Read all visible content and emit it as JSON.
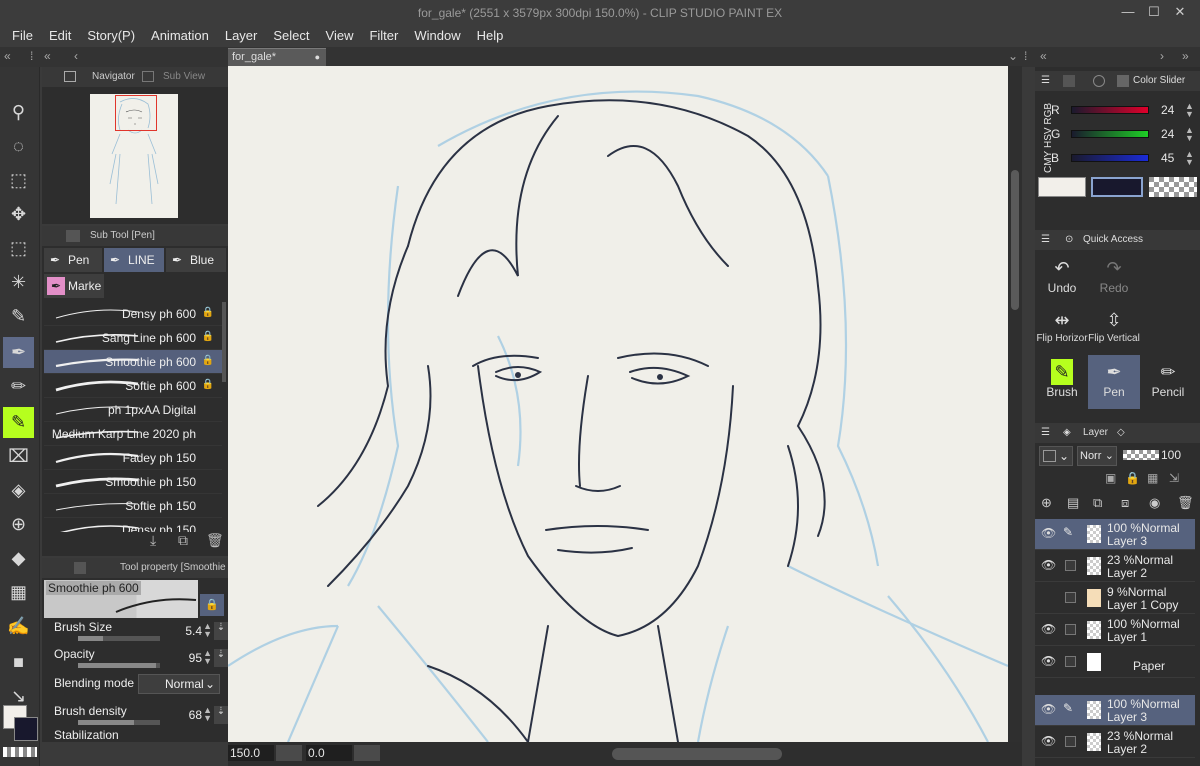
{
  "window": {
    "title": "for_gale* (2551 x 3579px 300dpi 150.0%)  - CLIP STUDIO PAINT EX",
    "minimize": "—",
    "maximize": "☐",
    "close": "✕"
  },
  "menu": [
    "File",
    "Edit",
    "Story(P)",
    "Animation",
    "Layer",
    "Select",
    "View",
    "Filter",
    "Window",
    "Help"
  ],
  "document_tab": {
    "label": "for_gale*"
  },
  "navigator": {
    "tab_navigator": "Navigator",
    "tab_subview": "Sub View"
  },
  "subtool": {
    "header": "Sub Tool [Pen]",
    "groups": [
      "Pen",
      "LINE",
      "Blue D",
      "Marke"
    ],
    "brushes": [
      {
        "name": "Densy ph 600",
        "locked": true
      },
      {
        "name": "Sang Line ph 600",
        "locked": true
      },
      {
        "name": "Smoothie ph 600",
        "locked": true,
        "selected": true
      },
      {
        "name": "Softie ph 600",
        "locked": true
      },
      {
        "name": "ph 1pxAA Digital",
        "locked": false
      },
      {
        "name": "Medium Karp Line 2020 ph",
        "locked": false
      },
      {
        "name": "Fadey ph 150",
        "locked": false
      },
      {
        "name": "Smoothie ph 150",
        "locked": false
      },
      {
        "name": "Softie ph 150",
        "locked": false
      },
      {
        "name": "Densy ph 150",
        "locked": false
      }
    ]
  },
  "toolprop": {
    "header": "Tool property [Smoothie",
    "brush_name": "Smoothie ph 600",
    "rows": [
      {
        "label": "Brush Size",
        "value": "5.4",
        "fill": 0.3
      },
      {
        "label": "Opacity",
        "value": "95",
        "fill": 0.95
      },
      {
        "label": "Blending mode",
        "value": "Normal"
      },
      {
        "label": "Brush density",
        "value": "68",
        "fill": 0.68
      },
      {
        "label": "Stabilization",
        "value": ""
      }
    ]
  },
  "status": {
    "zoom": "150.0",
    "angle": "0.0"
  },
  "color_slider": {
    "header": "Color Slider",
    "modes": [
      "RGB",
      "HSV",
      "CMY"
    ],
    "channels": [
      {
        "label": "R",
        "value": "24",
        "color": "#e0002b"
      },
      {
        "label": "G",
        "value": "24",
        "color": "#1ecf26"
      },
      {
        "label": "B",
        "value": "45",
        "color": "#1a2bd8"
      }
    ],
    "main_color": "#f2efea",
    "sub_color": "#18182d"
  },
  "quick_access": {
    "header": "Quick Access",
    "items": [
      {
        "label": "Undo",
        "icon": "undo-icon"
      },
      {
        "label": "Redo",
        "icon": "redo-icon"
      },
      {
        "label": "Flip Horizor",
        "icon": "flip-horizontal-icon"
      },
      {
        "label": "Flip Vertical",
        "icon": "flip-vertical-icon"
      },
      {
        "label": "Brush",
        "icon": "brush-icon"
      },
      {
        "label": "Pen",
        "icon": "pen-icon"
      },
      {
        "label": "Pencil",
        "icon": "pencil-icon"
      }
    ]
  },
  "layer_panel": {
    "header": "Layer",
    "blend": "Norr",
    "opacity": "100",
    "layers": [
      {
        "pct": "100 %",
        "mode": "Normal",
        "name": "Layer 3",
        "selected": true
      },
      {
        "pct": "23 %",
        "mode": "Normal",
        "name": "Layer 2"
      },
      {
        "pct": "9 %",
        "mode": "Normal",
        "name": "Layer 1 Copy"
      },
      {
        "pct": "100 %",
        "mode": "Normal",
        "name": "Layer 1"
      },
      {
        "pct": "",
        "mode": "",
        "name": "Paper"
      }
    ],
    "layers_b": [
      {
        "pct": "100 %",
        "mode": "Normal",
        "name": "Layer 3",
        "selected": true
      },
      {
        "pct": "23 %",
        "mode": "Normal",
        "name": "Layer 2"
      }
    ]
  }
}
